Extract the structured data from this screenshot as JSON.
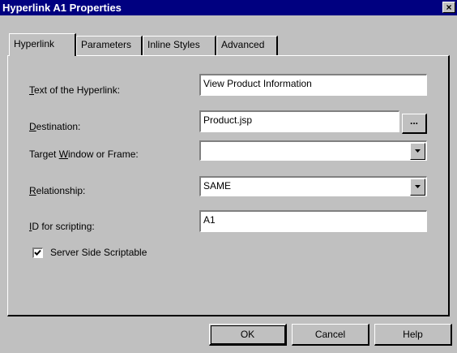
{
  "window": {
    "title": "Hyperlink A1 Properties",
    "close_glyph": "×"
  },
  "tabs": [
    {
      "label": "Hyperlink",
      "selected": true
    },
    {
      "label": "Parameters",
      "selected": false
    },
    {
      "label": "Inline Styles",
      "selected": false
    },
    {
      "label": "Advanced",
      "selected": false
    }
  ],
  "form": {
    "text_label": {
      "mnemonic": "T",
      "rest": "ext of the Hyperlink:"
    },
    "text_value": "View Product Information",
    "destination_label": {
      "mnemonic": "D",
      "rest": "estination:"
    },
    "destination_value": "Product.jsp",
    "browse_label": "...",
    "target_label": {
      "pre": "Target ",
      "mnemonic": "W",
      "rest": "indow or Frame:"
    },
    "target_value": "",
    "relationship_label": {
      "mnemonic": "R",
      "rest": "elationship:"
    },
    "relationship_value": "SAME",
    "id_label": {
      "mnemonic": "I",
      "rest": "D for scripting:"
    },
    "id_value": "A1",
    "server_side": {
      "label": "Server Side Scriptable",
      "checked": true
    }
  },
  "buttons": {
    "ok": "OK",
    "cancel": "Cancel",
    "help": "Help"
  }
}
